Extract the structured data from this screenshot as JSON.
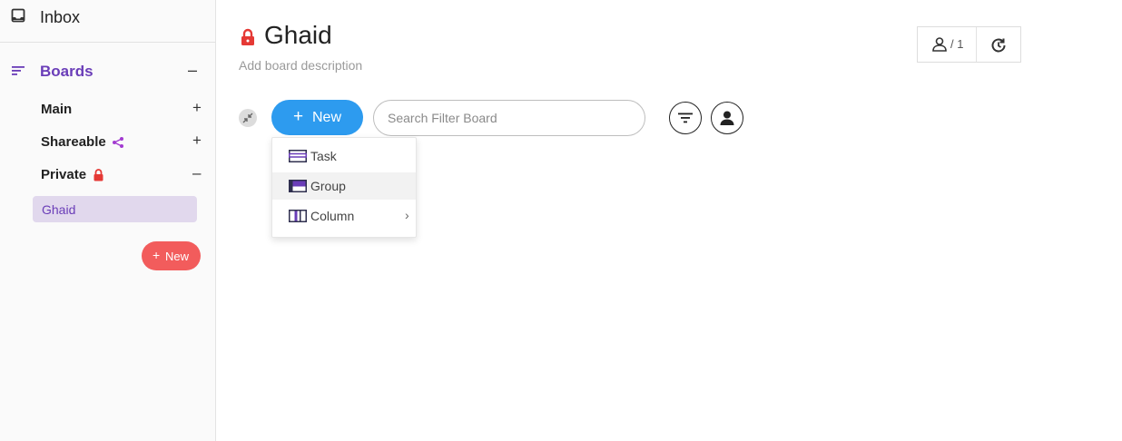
{
  "sidebar": {
    "inbox_label": "Inbox",
    "boards_label": "Boards",
    "boards_toggle": "–",
    "items": [
      {
        "label": "Main",
        "control": "+"
      },
      {
        "label": "Shareable",
        "control": "+"
      },
      {
        "label": "Private",
        "control": "–"
      }
    ],
    "active_board": "Ghaid",
    "new_button": {
      "icon": "+",
      "label": "New"
    }
  },
  "header": {
    "title": "Ghaid",
    "description_placeholder": "Add board description",
    "members_count": "/ 1"
  },
  "toolbar": {
    "new_button": {
      "icon": "+",
      "label": "New"
    },
    "search_placeholder": "Search Filter Board"
  },
  "new_menu": {
    "items": [
      {
        "label": "Task"
      },
      {
        "label": "Group"
      },
      {
        "label": "Column",
        "arrow": "›"
      }
    ]
  },
  "colors": {
    "accent_purple": "#6a3db8",
    "primary_blue": "#2d9bef",
    "danger_red": "#f25c5c",
    "lock_red": "#e53935",
    "active_pill": "#e1d8ed"
  },
  "icons": {
    "inbox": "inbox-icon",
    "boards": "sort-lines-icon",
    "share": "share-icon",
    "lock": "lock-icon",
    "members": "person-icon",
    "history": "history-icon",
    "collapse": "collapse-arrows-icon",
    "filter": "filter-icon",
    "person_filter": "person-icon"
  }
}
